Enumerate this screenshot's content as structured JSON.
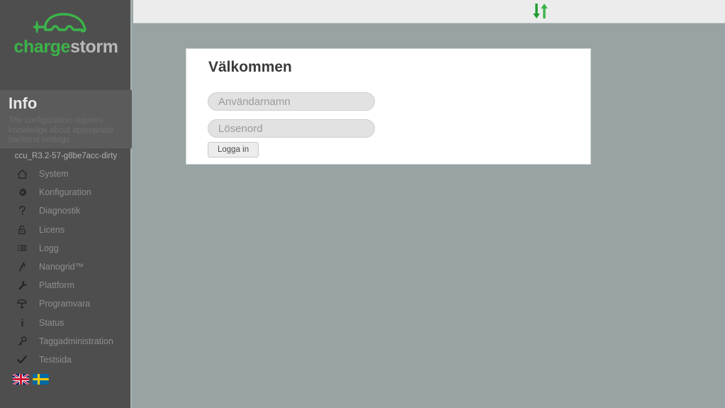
{
  "brand": {
    "name_part1": "charge",
    "name_part2": "storm",
    "logo_icon": "car-with-plug-icon",
    "green": "#3cb44a"
  },
  "sidebar": {
    "info": {
      "title": "Info",
      "text": "The configuration requires knowledge about appropriate backend settings"
    },
    "version": "ccu_R3.2-57-g8be7acc-dirty",
    "items": [
      {
        "label": "System",
        "icon": "home-icon"
      },
      {
        "label": "Konfiguration",
        "icon": "gear-icon"
      },
      {
        "label": "Diagnostik",
        "icon": "question-mark-icon"
      },
      {
        "label": "Licens",
        "icon": "lock-icon"
      },
      {
        "label": "Logg",
        "icon": "list-icon"
      },
      {
        "label": "Nanogrid™",
        "icon": "nanogrid-icon"
      },
      {
        "label": "Plattform",
        "icon": "wrench-icon"
      },
      {
        "label": "Programvara",
        "icon": "software-upload-icon"
      },
      {
        "label": "Status",
        "icon": "info-i-icon"
      },
      {
        "label": "Taggadministration",
        "icon": "key-icon"
      },
      {
        "label": "Testsida",
        "icon": "checkmark-icon"
      }
    ],
    "languages": [
      {
        "name": "english-flag-icon"
      },
      {
        "name": "swedish-flag-icon"
      }
    ]
  },
  "topbar": {
    "sync_icon": "up-down-arrows-icon"
  },
  "login": {
    "title": "Välkommen",
    "username_placeholder": "Användarnamn",
    "username_value": "",
    "password_placeholder": "Lösenord",
    "password_value": "",
    "submit_label": "Logga in"
  }
}
